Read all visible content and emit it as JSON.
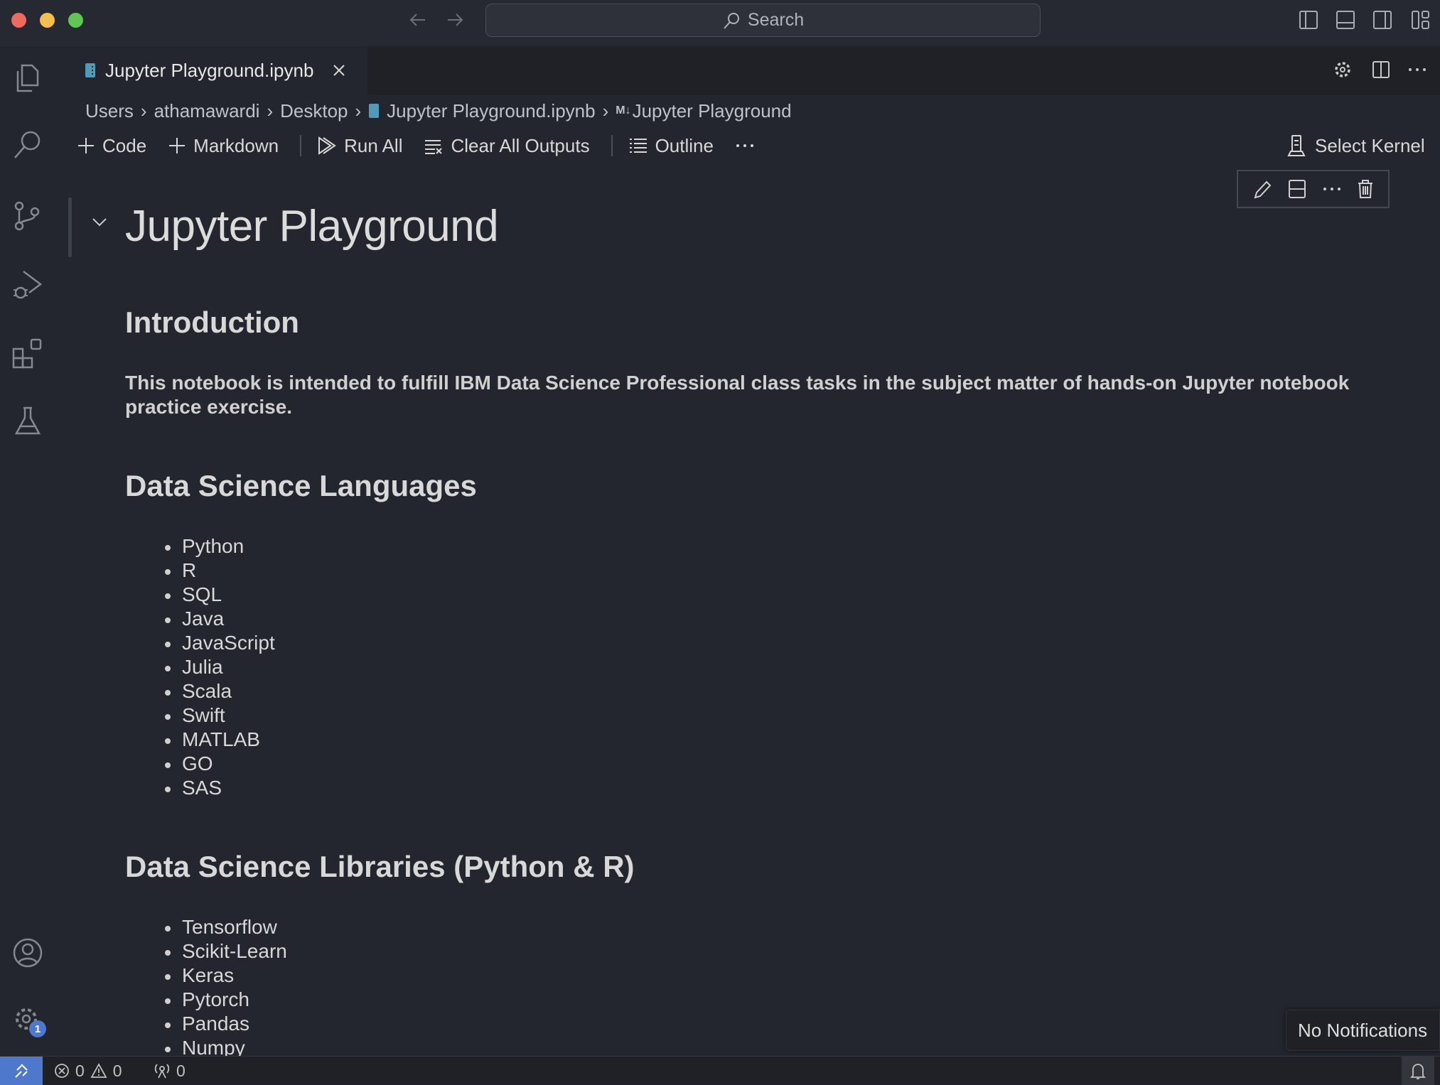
{
  "titlebar": {
    "search_placeholder": "Search"
  },
  "tab": {
    "label": "Jupyter Playground.ipynb"
  },
  "breadcrumb": [
    "Users",
    "athamawardi",
    "Desktop",
    "Jupyter Playground.ipynb",
    "Jupyter Playground"
  ],
  "toolbar": {
    "code": "Code",
    "markdown": "Markdown",
    "run_all": "Run All",
    "clear_outputs": "Clear All Outputs",
    "outline": "Outline",
    "select_kernel": "Select Kernel"
  },
  "notebook": {
    "title": "Jupyter Playground",
    "intro_heading": "Introduction",
    "intro_text": "This notebook is intended to fulfill IBM Data Science Professional class tasks in the subject matter of hands-on Jupyter notebook practice exercise.",
    "languages_heading": "Data Science Languages",
    "languages": [
      "Python",
      "R",
      "SQL",
      "Java",
      "JavaScript",
      "Julia",
      "Scala",
      "Swift",
      "MATLAB",
      "GO",
      "SAS"
    ],
    "libraries_heading": "Data Science Libraries (Python & R)",
    "libraries": [
      "Tensorflow",
      "Scikit-Learn",
      "Keras",
      "Pytorch",
      "Pandas",
      "Numpy"
    ]
  },
  "activity": {
    "settings_badge": "1"
  },
  "status": {
    "errors": "0",
    "warnings": "0",
    "ports": "0"
  },
  "notification": {
    "text": "No Notifications"
  },
  "colors": {
    "accent": "#4d78cc",
    "notebook_icon": "#519aba",
    "close": "#ed6a5e",
    "minimize": "#f5bf4f",
    "maximize": "#61c554"
  }
}
